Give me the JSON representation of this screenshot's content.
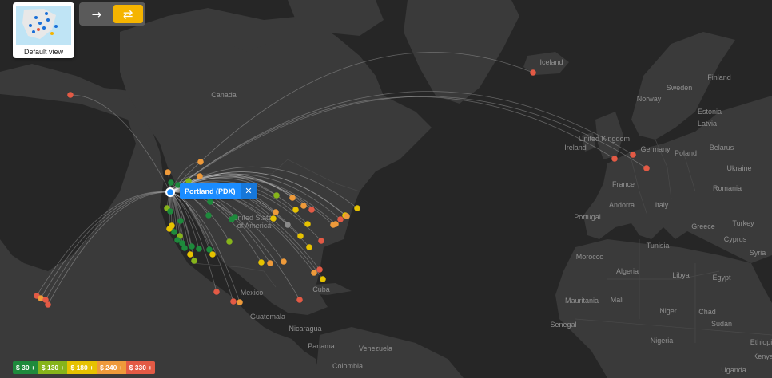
{
  "default_view": {
    "label": "Default view"
  },
  "direction_toggle": {
    "one_way_icon": "arrow-right-icon",
    "round_trip_icon": "swap-arrows-icon",
    "active": "round_trip"
  },
  "origin": {
    "label": "Portland (PDX)",
    "close_icon": "close-icon"
  },
  "legend": [
    {
      "label": "$ 30 +",
      "color": "#1e8a3c"
    },
    {
      "label": "$ 130 +",
      "color": "#86b41b"
    },
    {
      "label": "$ 180 +",
      "color": "#e6c200"
    },
    {
      "label": "$ 240 +",
      "color": "#ee9a3a"
    },
    {
      "label": "$ 330 +",
      "color": "#e35a45"
    }
  ],
  "map_labels": [
    "Canada",
    "United States of America",
    "Mexico",
    "Cuba",
    "Guatemala",
    "Nicaragua",
    "Panama",
    "Venezuela",
    "Colombia",
    "Iceland",
    "Norway",
    "Sweden",
    "Finland",
    "Estonia",
    "Latvia",
    "United Kingdom",
    "Ireland",
    "Germany",
    "Poland",
    "Belarus",
    "France",
    "Romania",
    "Italy",
    "Portugal",
    "Andorra",
    "Greece",
    "Turkey",
    "Ukraine",
    "Cyprus",
    "Syria",
    "Tunisia",
    "Morocco",
    "Algeria",
    "Libya",
    "Egypt",
    "Mauritania",
    "Mali",
    "Niger",
    "Chad",
    "Sudan",
    "Senegal",
    "Nigeria",
    "Ethiopia",
    "Uganda",
    "Kenya"
  ]
}
